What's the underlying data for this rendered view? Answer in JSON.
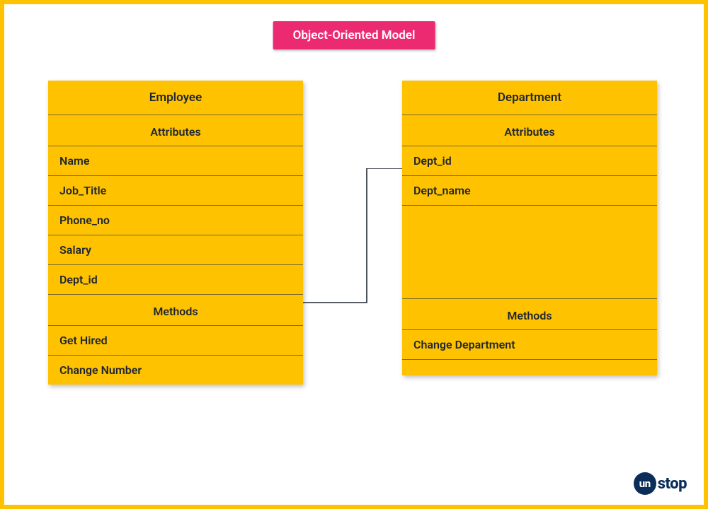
{
  "title": "Object-Oriented Model",
  "colors": {
    "frame": "#fec200",
    "title_bg": "#ec2a72",
    "title_fg": "#ffffff",
    "box_bg": "#fec200",
    "text": "#212732",
    "logo": "#0a2d5a"
  },
  "classes": {
    "left": {
      "name": "Employee",
      "attributes_label": "Attributes",
      "attributes": [
        "Name",
        "Job_Title",
        "Phone_no",
        "Salary",
        "Dept_id"
      ],
      "methods_label": "Methods",
      "methods": [
        "Get Hired",
        "Change Number"
      ]
    },
    "right": {
      "name": "Department",
      "attributes_label": "Attributes",
      "attributes": [
        "Dept_id",
        "Dept_name"
      ],
      "methods_label": "Methods",
      "methods": [
        "Change Department"
      ]
    }
  },
  "connector": {
    "from": "left.attributes.Dept_id",
    "to": "right.attributes.Dept_id"
  },
  "logo": {
    "badge": "un",
    "rest": "stop"
  }
}
